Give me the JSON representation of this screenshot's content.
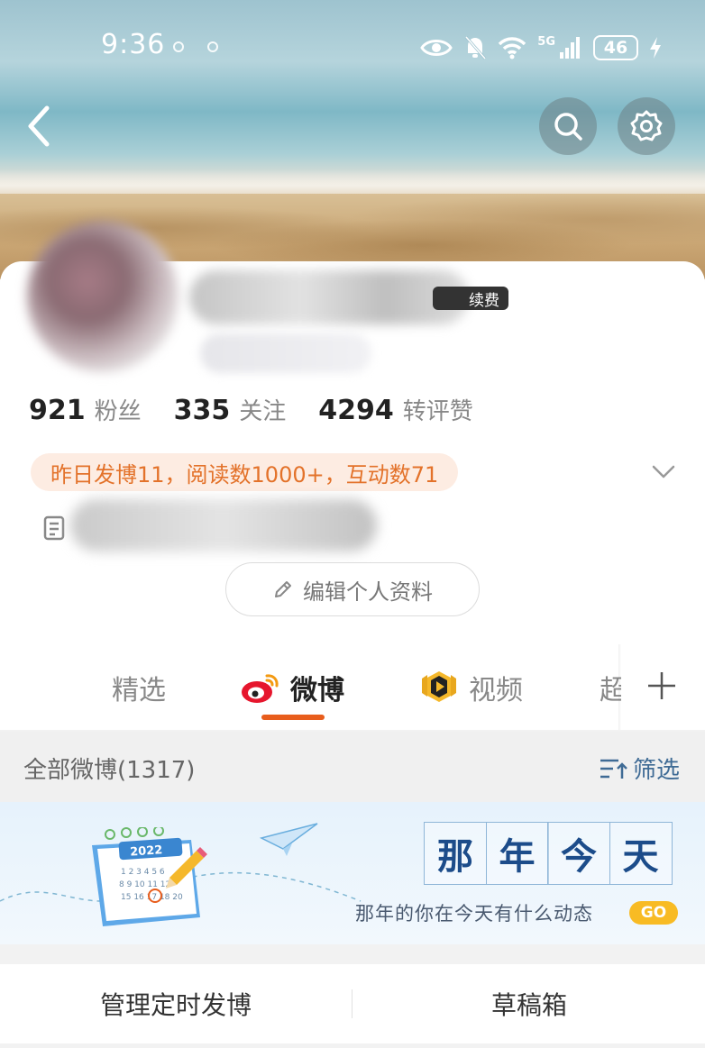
{
  "status_bar": {
    "time": "9:36",
    "network": "5G",
    "battery": "46"
  },
  "header": {
    "back_icon": "back-arrow-icon",
    "search_icon": "search-icon",
    "settings_icon": "gear-icon"
  },
  "profile": {
    "vip_badge": "续费",
    "stats": [
      {
        "value": "921",
        "label": "粉丝"
      },
      {
        "value": "335",
        "label": "关注"
      },
      {
        "value": "4294",
        "label": "转评赞"
      }
    ],
    "daily_summary": "昨日发博11，阅读数1000+，互动数71",
    "edit_button": "编辑个人资料"
  },
  "tabs": [
    {
      "label": "精选"
    },
    {
      "label": "微博"
    },
    {
      "label": "视频"
    },
    {
      "label": "超"
    }
  ],
  "filter_bar": {
    "all_posts": "全部微博(1317)",
    "filter": "筛选"
  },
  "banner": {
    "title_chars": [
      "那",
      "年",
      "今",
      "天"
    ],
    "tagline": "那年的你在今天有什么动态",
    "go": "GO",
    "calendar_year": "2022"
  },
  "bottom_actions": {
    "scheduled": "管理定时发博",
    "drafts": "草稿箱"
  },
  "colors": {
    "accent": "#e85d1c",
    "link": "#3f6b95",
    "pill_bg": "#fdece2",
    "pill_text": "#e3722a"
  }
}
